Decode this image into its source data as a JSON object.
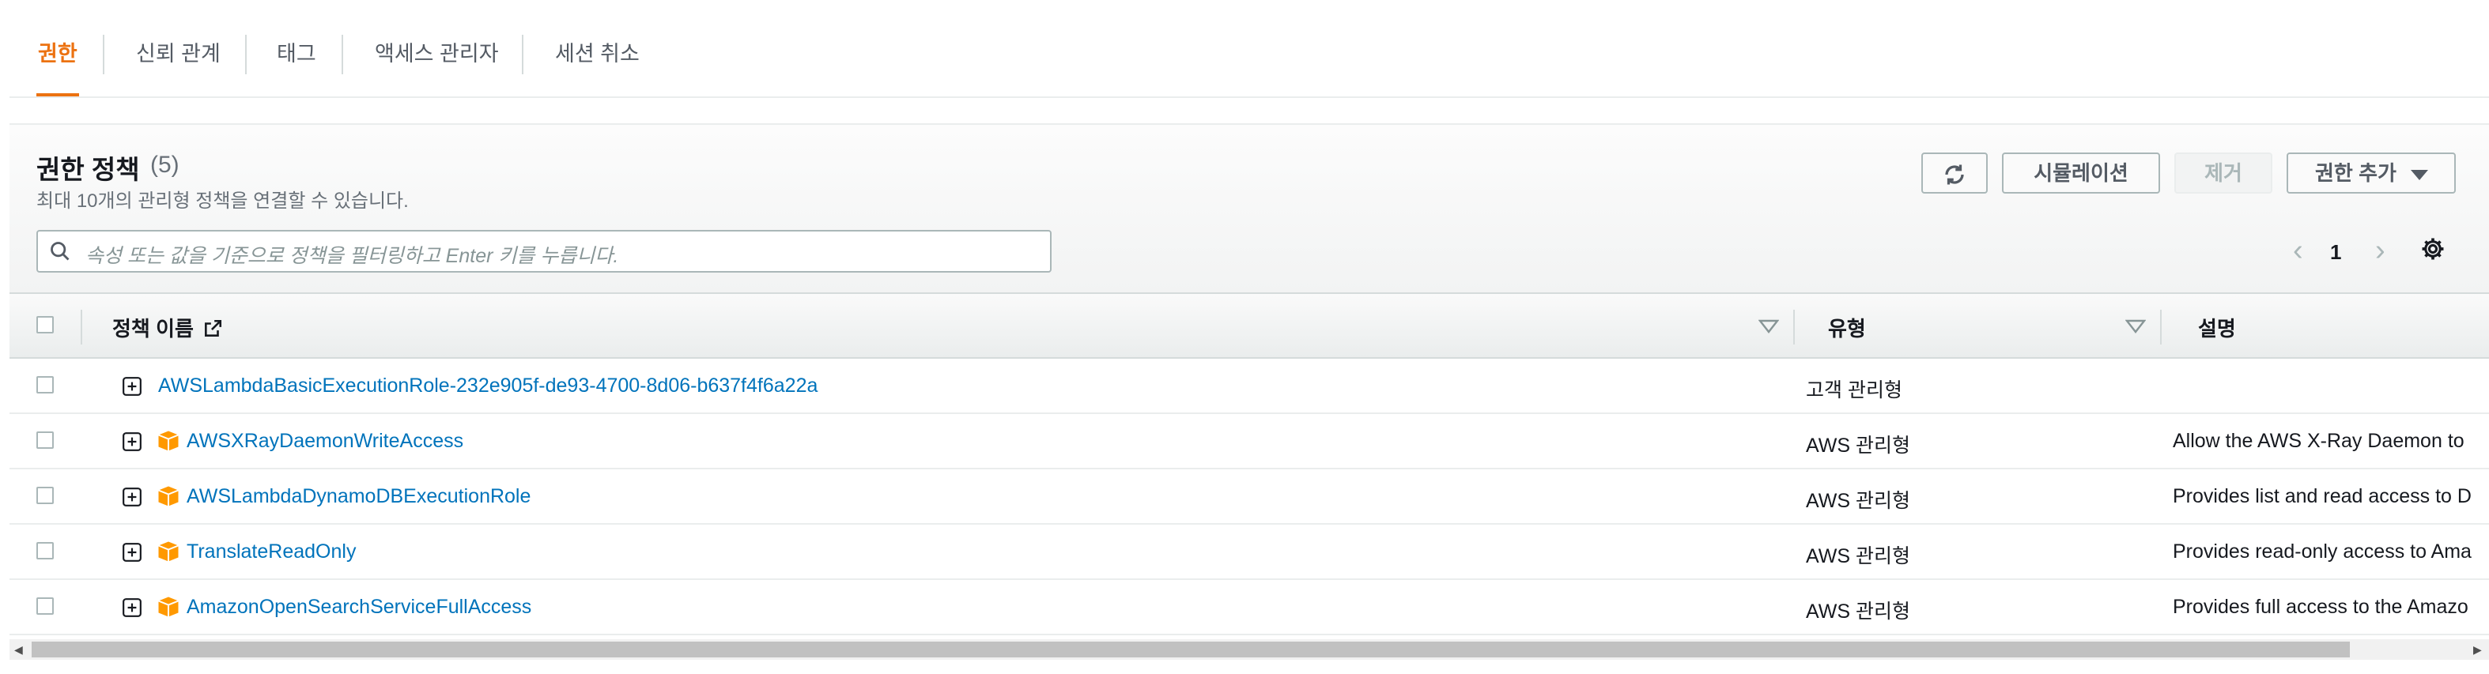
{
  "tabs": [
    {
      "label": "권한",
      "active": true
    },
    {
      "label": "신뢰 관계"
    },
    {
      "label": "태그"
    },
    {
      "label": "액세스 관리자"
    },
    {
      "label": "세션 취소"
    }
  ],
  "panel": {
    "title": "권한 정책",
    "count": "(5)",
    "description": "최대 10개의 관리형 정책을 연결할 수 있습니다.",
    "buttons": {
      "refresh_icon": "refresh-icon",
      "simulation": "시뮬레이션",
      "remove": "제거",
      "add_permissions": "권한 추가"
    },
    "search": {
      "placeholder": "속성 또는 값을 기준으로 정책을 필터링하고 Enter 키를 누릅니다."
    },
    "pagination": {
      "prev": "‹",
      "page": "1",
      "next": "›"
    }
  },
  "table": {
    "columns": {
      "policy_name": "정책 이름",
      "type": "유형",
      "description": "설명"
    },
    "rows": [
      {
        "name": "AWSLambdaBasicExecutionRole-232e905f-de93-4700-8d06-b637f4f6a22a",
        "type": "고객 관리형",
        "description": "",
        "aws_managed": false
      },
      {
        "name": "AWSXRayDaemonWriteAccess",
        "type": "AWS 관리형",
        "description": "Allow the AWS X-Ray Daemon to",
        "aws_managed": true
      },
      {
        "name": "AWSLambdaDynamoDBExecutionRole",
        "type": "AWS 관리형",
        "description": "Provides list and read access to D",
        "aws_managed": true
      },
      {
        "name": "TranslateReadOnly",
        "type": "AWS 관리형",
        "description": "Provides read-only access to Ama",
        "aws_managed": true
      },
      {
        "name": "AmazonOpenSearchServiceFullAccess",
        "type": "AWS 관리형",
        "description": "Provides full access to the Amazo",
        "aws_managed": true
      }
    ]
  },
  "colors": {
    "accent": "#ec7211",
    "link": "#0073bb",
    "aws_icon": "#f90"
  }
}
